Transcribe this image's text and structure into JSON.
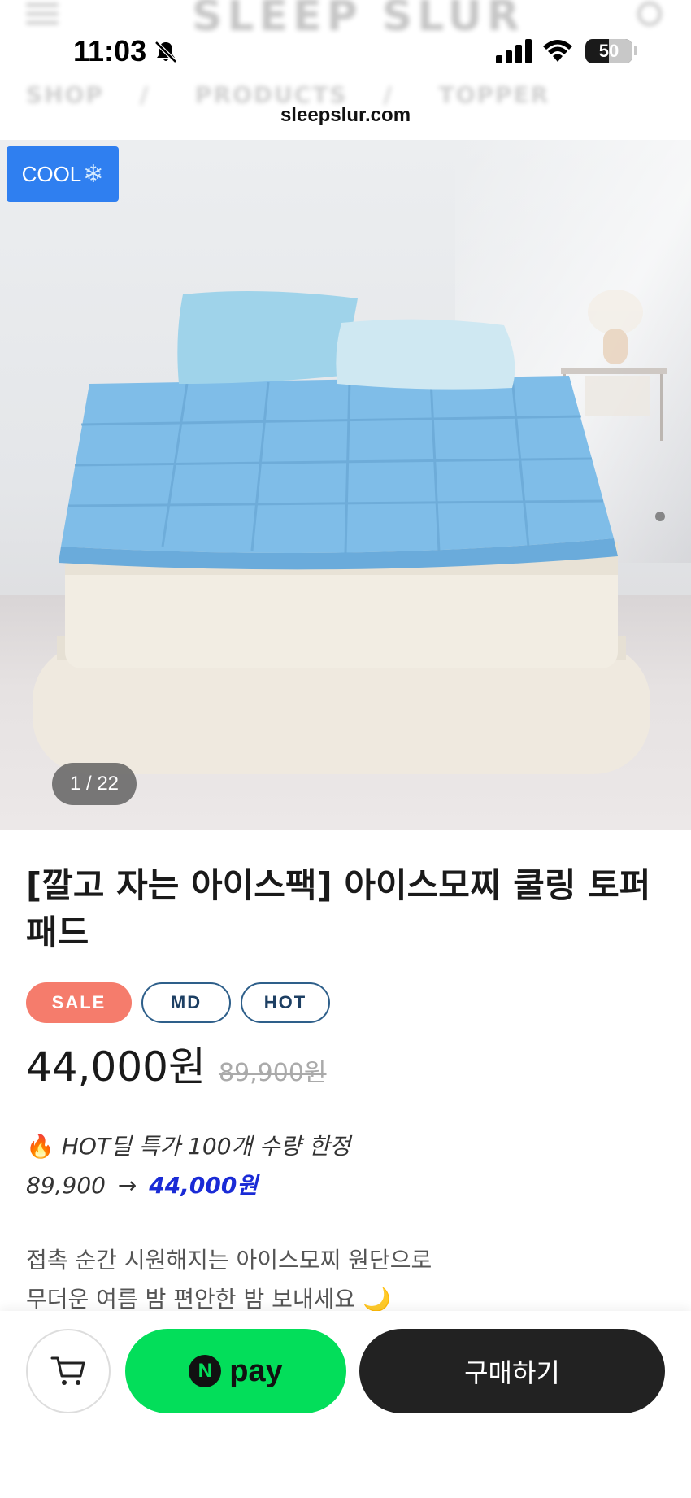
{
  "status_bar": {
    "time": "11:03",
    "battery": "50",
    "url": "sleepslur.com"
  },
  "header": {
    "logo": "SLEEP SLUR",
    "breadcrumbs": [
      "SHOP",
      "PRODUCTS",
      "TOPPER"
    ]
  },
  "gallery": {
    "badge": "COOL",
    "badge_icon": "❄",
    "counter": "1 / 22"
  },
  "product": {
    "title": "[깔고 자는 아이스팩] 아이스모찌 쿨링 토퍼패드",
    "badges": [
      "SALE",
      "MD",
      "HOT"
    ],
    "price": "44,000원",
    "original_price": "89,900원",
    "deal_headline": "HOT딜 특가 100개 수량 한정",
    "deal_from": "89,900",
    "deal_arrow": "→",
    "deal_to": "44,000원",
    "description_line1": "접촉 순간 시원해지는 아이스모찌 원단으로",
    "description_line2": "무더운 여름 밤 편안한 밤 보내세요"
  },
  "actions": {
    "npay_mark": "N",
    "npay_label": "pay",
    "buy_label": "구매하기"
  },
  "colors": {
    "accent_sale": "#f57c6c",
    "npay_green": "#03de5a",
    "deal_blue": "#1a2bd6",
    "buy_dark": "#222222"
  }
}
